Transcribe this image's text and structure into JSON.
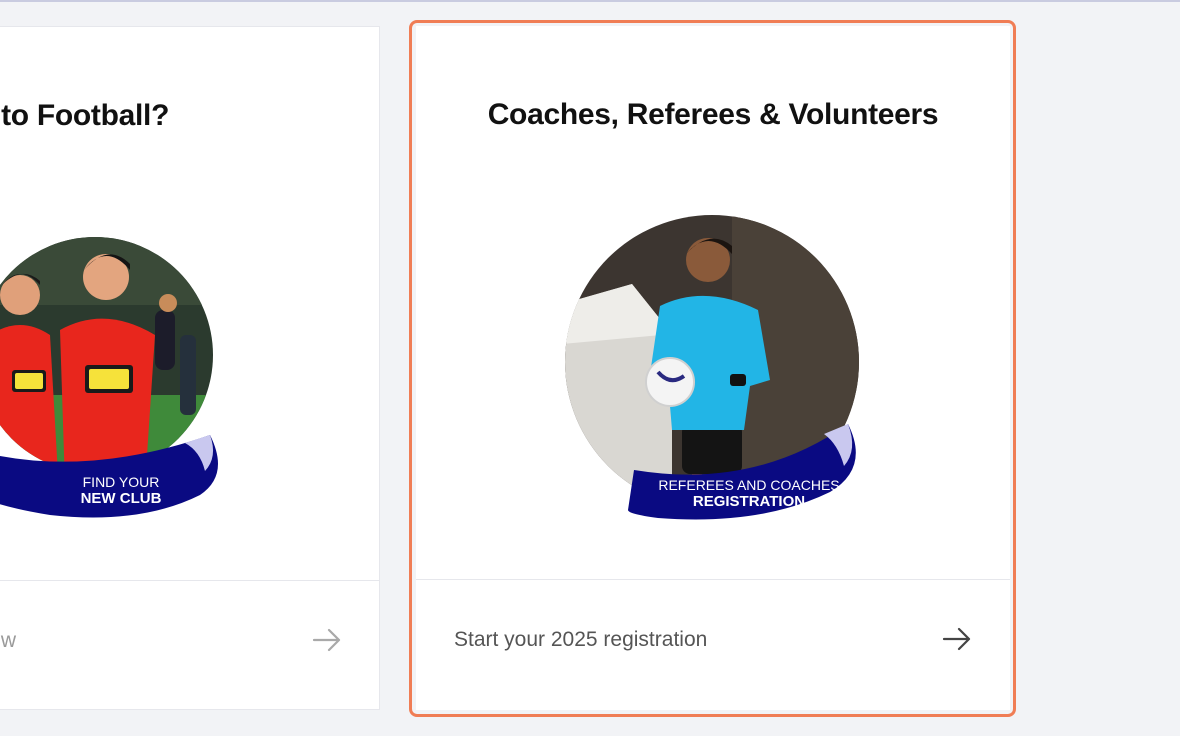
{
  "cards": [
    {
      "title": "w to Football?",
      "cta_label": "Now",
      "cta_icon": "arrow-right-icon",
      "banner": {
        "line1": "FIND YOUR",
        "line2": "NEW CLUB"
      }
    },
    {
      "title": "Coaches, Referees & Volunteers",
      "cta_label": "Start your 2025 registration",
      "cta_icon": "arrow-right-icon",
      "banner": {
        "line1": "REFEREES AND COACHES",
        "line2": "REGISTRATION"
      }
    }
  ],
  "colors": {
    "page_bg": "#f2f3f6",
    "focus_ring": "#f07d55",
    "banner_navy": "#0a0a82",
    "kit_red": "#e8261d",
    "referee_cyan": "#22b5e6"
  }
}
